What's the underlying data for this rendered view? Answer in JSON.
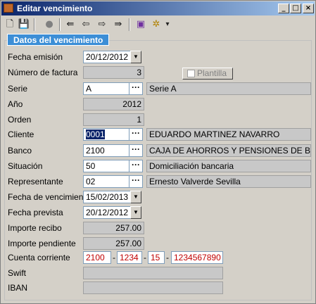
{
  "window": {
    "title": "Editar vencimiento"
  },
  "titlebar_buttons": {
    "minimize": "_",
    "maximize": "□",
    "close": "×"
  },
  "toolbar": {
    "items": [
      "new-icon",
      "save-icon",
      "delete-icon",
      "first-icon",
      "prev-icon",
      "next-icon",
      "last-icon",
      "book-icon",
      "settings-icon"
    ],
    "dropdown": "▾"
  },
  "group": {
    "title": "Datos del vencimiento"
  },
  "labels": {
    "fecha_emision": "Fecha emisión",
    "numero_factura": "Número de factura",
    "serie": "Serie",
    "anio": "Año",
    "orden": "Orden",
    "cliente": "Cliente",
    "banco": "Banco",
    "situacion": "Situación",
    "representante": "Representante",
    "fecha_vencimiento": "Fecha de vencimiento",
    "fecha_prevista": "Fecha prevista",
    "importe_recibo": "Importe recibo",
    "importe_pendiente": "Importe pendiente",
    "cuenta_corriente": "Cuenta corriente",
    "swift": "Swift",
    "iban": "IBAN"
  },
  "values": {
    "fecha_emision": "20/12/2012",
    "numero_factura": "3",
    "serie_code": "A",
    "serie_name": "Serie A",
    "anio": "2012",
    "orden": "1",
    "cliente_code": "0001",
    "cliente_name": "EDUARDO MARTINEZ NAVARRO",
    "banco_code": "2100",
    "banco_name": "CAJA DE AHORROS Y PENSIONES DE BARCE",
    "situacion_code": "50",
    "situacion_name": "Domiciliación bancaria",
    "representante_code": "02",
    "representante_name": "Ernesto Valverde Sevilla",
    "fecha_vencimiento": "15/02/2013",
    "fecha_prevista": "20/12/2012",
    "importe_recibo": "257.00",
    "importe_pendiente": "257.00",
    "cc_entidad": "2100",
    "cc_oficina": "1234",
    "cc_dc": "15",
    "cc_cuenta": "1234567890",
    "swift": "",
    "iban": ""
  },
  "plantilla": {
    "label": "Plantilla",
    "checked": false
  },
  "glyphs": {
    "dropdown": "▼",
    "dots": "···",
    "dash": "-"
  }
}
